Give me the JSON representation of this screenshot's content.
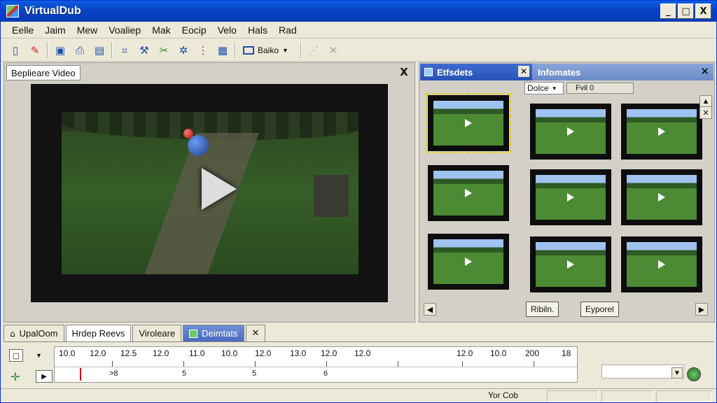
{
  "window": {
    "title": "VirtualDub",
    "controls": [
      "_",
      "□",
      "X"
    ]
  },
  "menu": [
    "Eelle",
    "Jaim",
    "Mew",
    "Voaliep",
    "Mak",
    "Eocip",
    "Velo",
    "Hals",
    "Rad"
  ],
  "toolbar": {
    "icons": [
      "new-file-icon",
      "wand-icon",
      "open-icon",
      "save-icon",
      "film-icon",
      "crop-icon",
      "tools-icon",
      "cut-icon",
      "star-icon",
      "filter-icon",
      "export-icon"
    ],
    "dropdown_label": "Baiko"
  },
  "preview": {
    "tab_label": "Beplieare Video",
    "close": "X"
  },
  "effects_panel": {
    "tab_effects": "Etfsdets",
    "tab_info": "Infomates",
    "sort_value": "Dolce",
    "filter_value": "Fvil 0",
    "buttons": {
      "apply": "Ribiln.",
      "export": "Eyporel"
    }
  },
  "bottom_tabs": [
    "UpalOom",
    "Hrdep Reevs",
    "Viroleare",
    "Deimtats"
  ],
  "timeline": {
    "ticks": [
      "10.0",
      "12.0",
      "12.5",
      "12.0",
      "11.0",
      "10.0",
      "12.0",
      "13.0",
      "12.0",
      "12.0",
      "12.0",
      "10.0",
      "200",
      "18"
    ],
    "track_labels": [
      ">8",
      "5",
      "5",
      "6"
    ]
  },
  "status": {
    "text": "Yor Cob"
  }
}
